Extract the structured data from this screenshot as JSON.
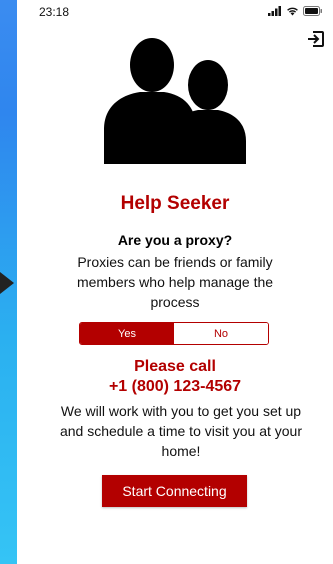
{
  "status_bar": {
    "time": "23:18"
  },
  "icons": {
    "exit": "exit-icon",
    "silhouette": "people-silhouette-icon",
    "side_arrow": "play-arrow-icon"
  },
  "header": {
    "title": "Help Seeker"
  },
  "proxy": {
    "question": "Are you a proxy?",
    "explanation": "Proxies can be friends or family members who help manage the process"
  },
  "toggle": {
    "yes_label": "Yes",
    "no_label": "No",
    "selected": "Yes"
  },
  "call": {
    "title": "Please call",
    "number": "+1 (800) 123-4567",
    "text": "We will work with you to get you set up and schedule a time to visit you at your home!"
  },
  "actions": {
    "start_label": "Start Connecting"
  },
  "colors": {
    "accent": "#b30000",
    "background_gradient_top": "#3b8cf0",
    "background_gradient_bottom": "#35c4f5"
  }
}
